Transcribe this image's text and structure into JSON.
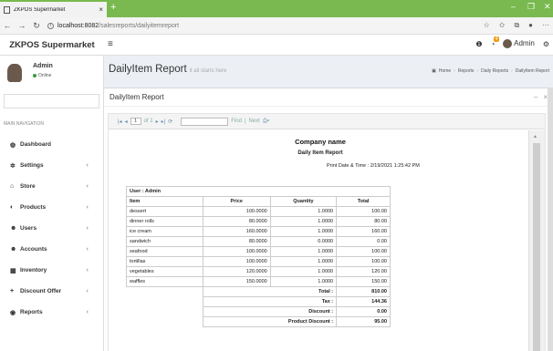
{
  "browser": {
    "tab_title": "ZKPOS Supermarket",
    "tab_close": "×",
    "new_tab": "+",
    "url_host": "localhost:8082",
    "url_path": "/salesreports/dailyitemreport",
    "win_min": "–",
    "win_max": "❐",
    "win_close": "✕",
    "icons": [
      "back-icon",
      "forward-icon",
      "reload-icon",
      "info-icon",
      "star-icon",
      "favorites-icon",
      "collections-icon",
      "profile-icon",
      "more-icon"
    ]
  },
  "app": {
    "brand": "ZKPOS Supermarket",
    "user_name": "Admin",
    "notification_count": "4",
    "user": {
      "name": "Admin",
      "status": "Online"
    }
  },
  "sidebar": {
    "header": "MAIN NAVIGATION",
    "items": [
      {
        "label": "Dashboard",
        "icon": "dashboard-icon",
        "glyph": "◍",
        "has_children": false
      },
      {
        "label": "Settings",
        "icon": "settings-icon",
        "glyph": "✲",
        "has_children": true
      },
      {
        "label": "Store",
        "icon": "store-icon",
        "glyph": "⌂",
        "has_children": true
      },
      {
        "label": "Products",
        "icon": "products-icon",
        "glyph": "◐",
        "has_children": true
      },
      {
        "label": "Users",
        "icon": "users-icon",
        "glyph": "☻",
        "has_children": true
      },
      {
        "label": "Accounts",
        "icon": "accounts-icon",
        "glyph": "☻",
        "has_children": true
      },
      {
        "label": "Inventory",
        "icon": "inventory-icon",
        "glyph": "▦",
        "has_children": true
      },
      {
        "label": "Discount Offer",
        "icon": "plus-icon",
        "glyph": "+",
        "has_children": true
      },
      {
        "label": "Reports",
        "icon": "reports-icon",
        "glyph": "◉",
        "has_children": true
      }
    ]
  },
  "page": {
    "title": "DailyItem Report",
    "subtitle": "it all starts here",
    "breadcrumb": [
      "Home",
      "Reports",
      "Daily Reports",
      "DailyItem Report"
    ],
    "box_title": "DailyItem Report"
  },
  "viewer": {
    "page_current": "1",
    "page_of": "of 1",
    "find": "Find",
    "next": "Next"
  },
  "report": {
    "company": "Company name",
    "title": "Daily Item Report",
    "print_date_label": "Print Date & Time :",
    "print_date": "2/19/2021 1:25:42 PM",
    "user_label": "User : Admin",
    "columns": [
      "Item",
      "Price",
      "Quantity",
      "Total"
    ],
    "rows": [
      [
        "dessert",
        "100.0000",
        "1.0000",
        "100.00"
      ],
      [
        "dinner rolls",
        "80.0000",
        "1.0000",
        "80.00"
      ],
      [
        "ice cream",
        "160.0000",
        "1.0000",
        "160.00"
      ],
      [
        "sandwich",
        "80.0000",
        "0.0000",
        "0.00"
      ],
      [
        "seafood",
        "100.0000",
        "1.0000",
        "100.00"
      ],
      [
        "tortillas",
        "100.0000",
        "1.0000",
        "100.00"
      ],
      [
        "vegetables",
        "120.0000",
        "1.0000",
        "120.00"
      ],
      [
        "waffles",
        "150.0000",
        "1.0000",
        "150.00"
      ]
    ],
    "summary": [
      {
        "label": "Total :",
        "value": "810.00"
      },
      {
        "label": "Tax :",
        "value": "144.36"
      },
      {
        "label": "Discount :",
        "value": "0.00"
      },
      {
        "label": "Product Discount :",
        "value": "95.00"
      }
    ]
  }
}
